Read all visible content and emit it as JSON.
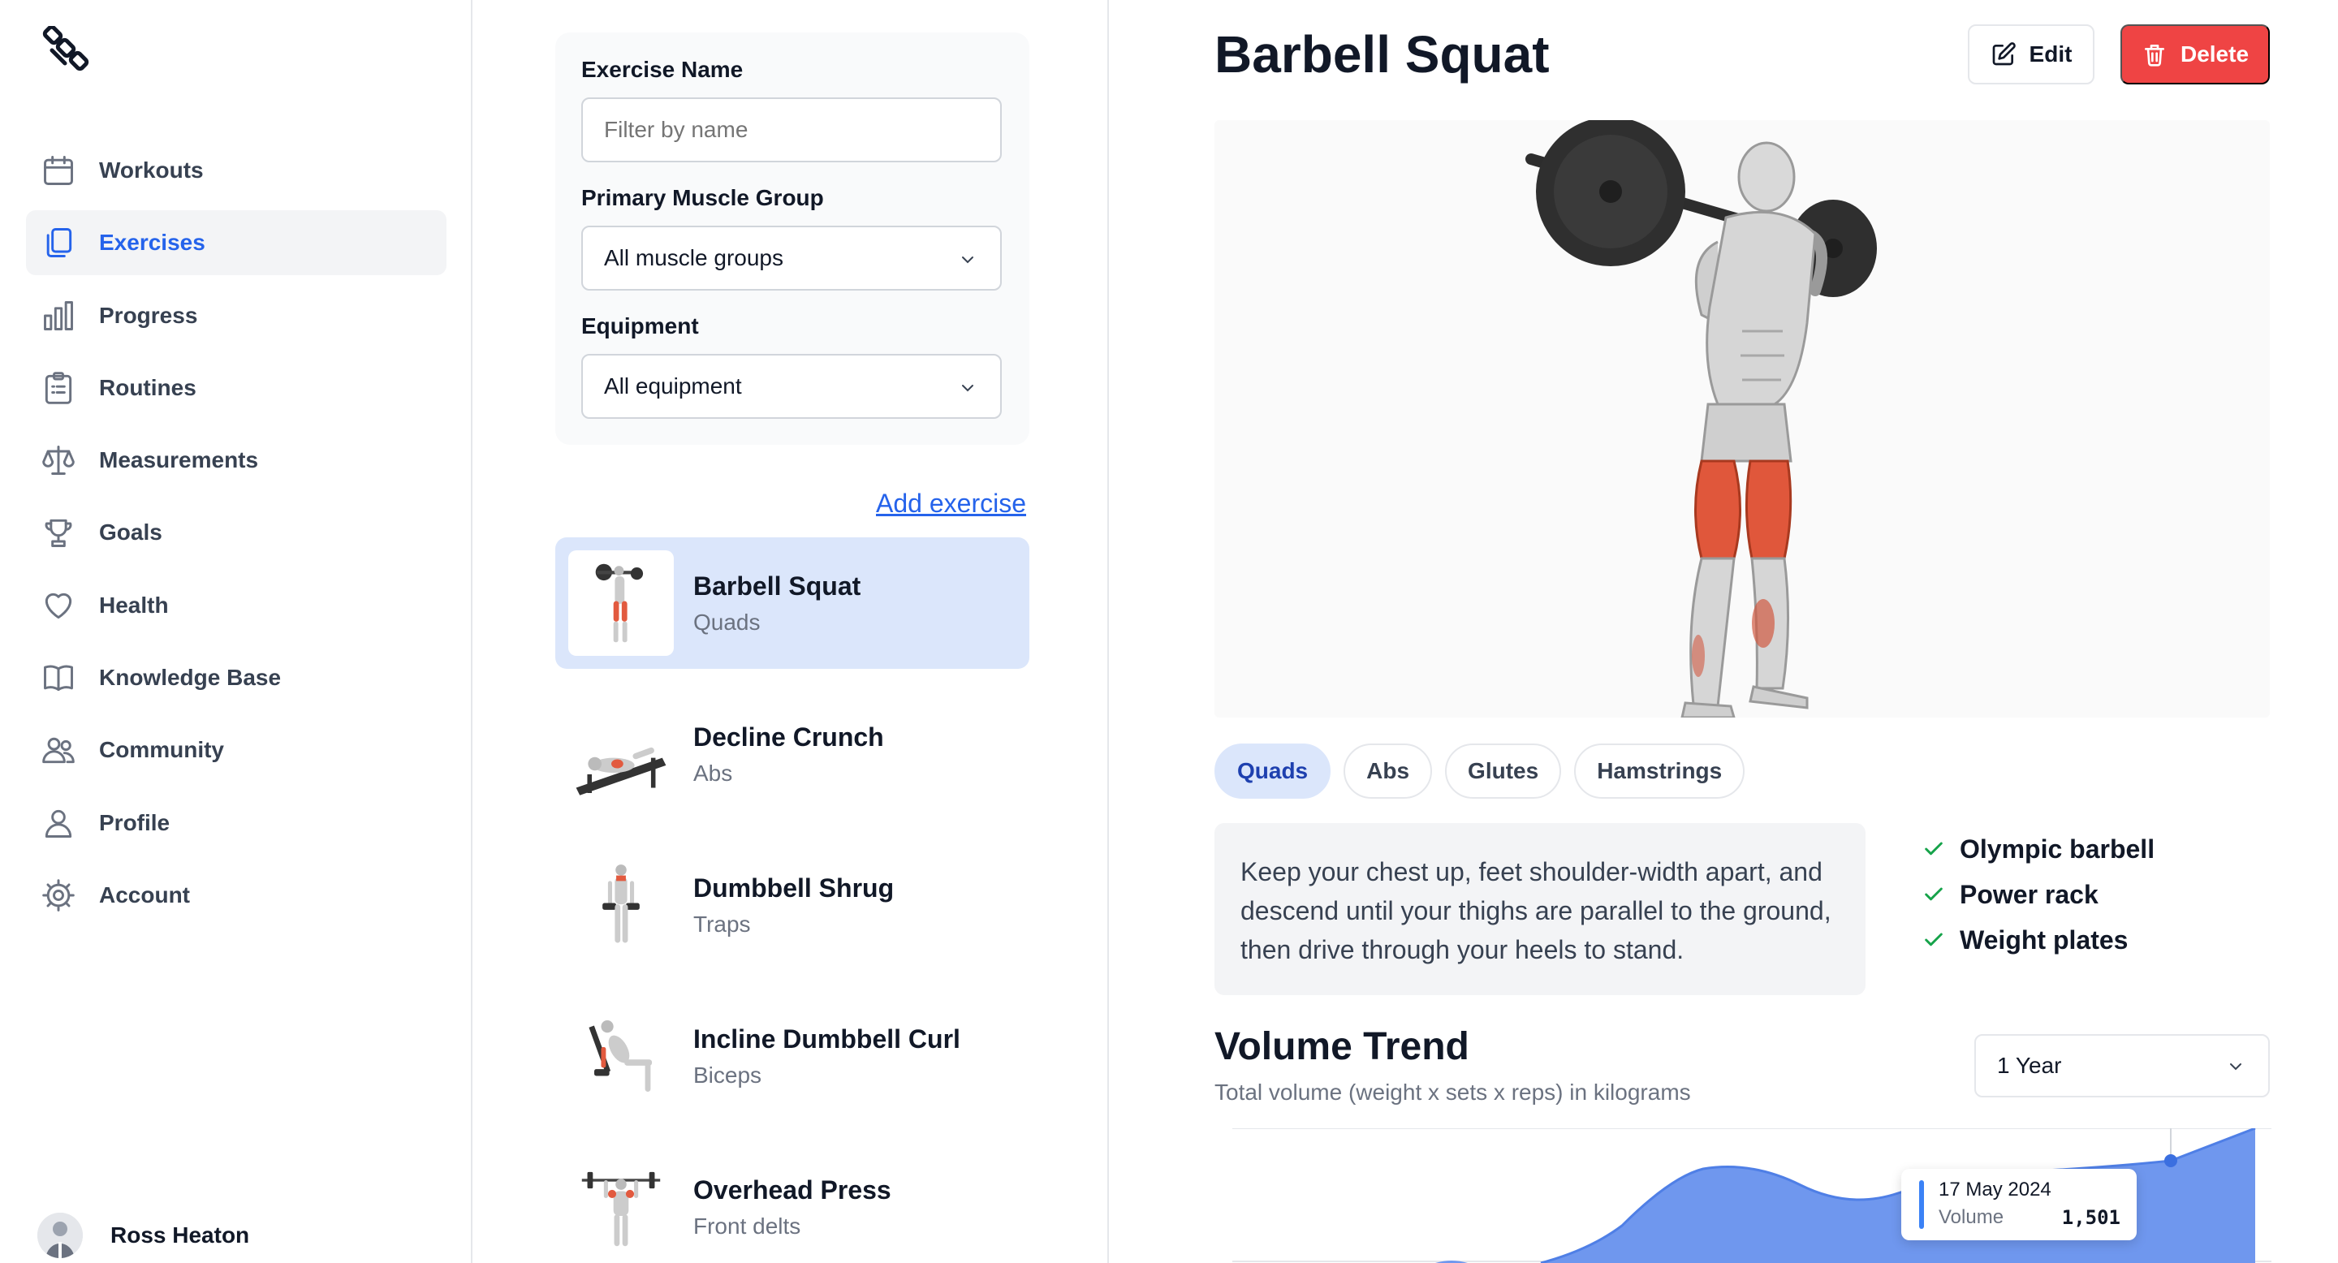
{
  "sidebar": {
    "items": [
      {
        "label": "Workouts",
        "icon": "calendar-icon"
      },
      {
        "label": "Exercises",
        "icon": "documents-icon",
        "active": true
      },
      {
        "label": "Progress",
        "icon": "bar-chart-icon"
      },
      {
        "label": "Routines",
        "icon": "clipboard-list-icon"
      },
      {
        "label": "Measurements",
        "icon": "scale-icon"
      },
      {
        "label": "Goals",
        "icon": "trophy-icon"
      },
      {
        "label": "Health",
        "icon": "heart-icon"
      },
      {
        "label": "Knowledge Base",
        "icon": "book-icon"
      },
      {
        "label": "Community",
        "icon": "users-icon"
      },
      {
        "label": "Profile",
        "icon": "user-icon"
      },
      {
        "label": "Account",
        "icon": "gear-icon"
      }
    ],
    "user_name": "Ross Heaton"
  },
  "filters": {
    "name_label": "Exercise Name",
    "name_placeholder": "Filter by name",
    "muscle_label": "Primary Muscle Group",
    "muscle_value": "All muscle groups",
    "equipment_label": "Equipment",
    "equipment_value": "All equipment"
  },
  "add_exercise_label": "Add exercise",
  "exercises": [
    {
      "name": "Barbell Squat",
      "muscle": "Quads",
      "selected": true
    },
    {
      "name": "Decline Crunch",
      "muscle": "Abs"
    },
    {
      "name": "Dumbbell Shrug",
      "muscle": "Traps"
    },
    {
      "name": "Incline Dumbbell Curl",
      "muscle": "Biceps"
    },
    {
      "name": "Overhead Press",
      "muscle": "Front delts"
    }
  ],
  "detail": {
    "title": "Barbell Squat",
    "edit_label": "Edit",
    "delete_label": "Delete",
    "tags": [
      "Quads",
      "Abs",
      "Glutes",
      "Hamstrings"
    ],
    "instructions": "Keep your chest up, feet shoulder-width apart, and descend until your thighs are parallel to the ground, then drive through your heels to stand.",
    "equipment": [
      "Olympic barbell",
      "Power rack",
      "Weight plates"
    ],
    "volume_title": "Volume Trend",
    "volume_subtitle": "Total volume (weight x sets x reps) in kilograms",
    "range_value": "1 Year",
    "tooltip": {
      "date": "17 May 2024",
      "label": "Volume",
      "value": "1,501"
    }
  },
  "colors": {
    "accent": "#2563eb",
    "danger": "#ef4444",
    "selected_bg": "#dbe6fb",
    "chart_fill": "#6f97ee",
    "check": "#16a34a"
  }
}
